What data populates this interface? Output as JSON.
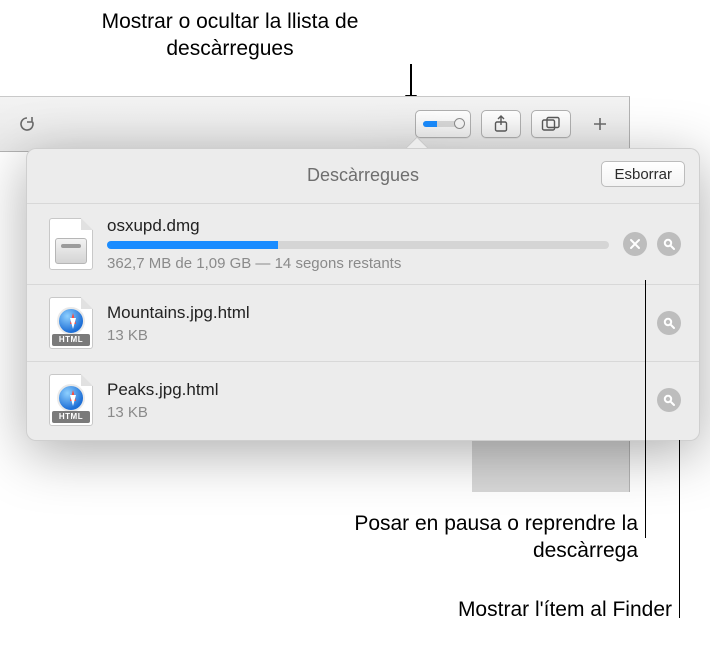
{
  "callouts": {
    "toggle_list": "Mostrar o ocultar la llista de descàrregues",
    "pause_resume": "Posar en pausa o reprendre la descàrrega",
    "show_in_finder": "Mostrar l'ítem al Finder"
  },
  "popover": {
    "title": "Descàrregues",
    "clear_label": "Esborrar"
  },
  "downloads": [
    {
      "name": "osxupd.dmg",
      "status": "362,7 MB de 1,09 GB — 14 segons restants",
      "progress_pct": 34,
      "icon": "dmg",
      "in_progress": true
    },
    {
      "name": "Mountains.jpg.html",
      "status": "13 KB",
      "icon": "html",
      "in_progress": false
    },
    {
      "name": "Peaks.jpg.html",
      "status": "13 KB",
      "icon": "html",
      "in_progress": false
    }
  ],
  "icon_labels": {
    "html_badge": "HTML"
  }
}
